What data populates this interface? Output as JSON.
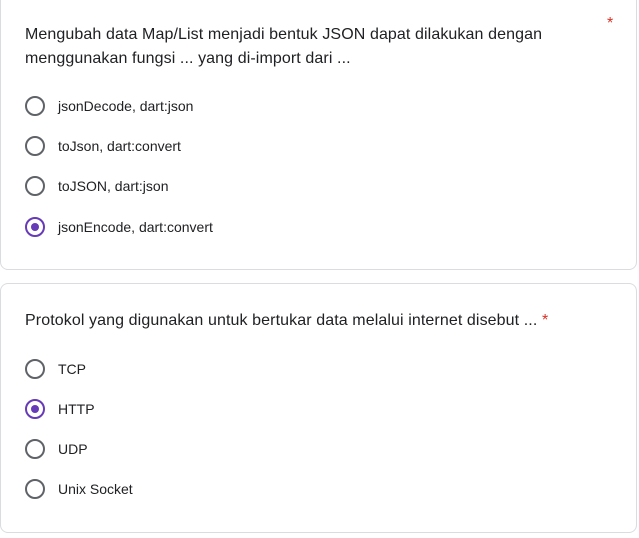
{
  "questions": [
    {
      "line1": "Mengubah data Map/List menjadi bentuk JSON dapat dilakukan dengan",
      "line2": "menggunakan fungsi ... yang di-import dari ...",
      "required_mark": "*",
      "options": [
        {
          "label": "jsonDecode, dart:json",
          "selected": false
        },
        {
          "label": "toJson, dart:convert",
          "selected": false
        },
        {
          "label": "toJSON, dart:json",
          "selected": false
        },
        {
          "label": "jsonEncode, dart:convert",
          "selected": true
        }
      ]
    },
    {
      "line1": "Protokol yang digunakan untuk bertukar data melalui internet disebut ...",
      "required_mark": "*",
      "options": [
        {
          "label": "TCP",
          "selected": false
        },
        {
          "label": "HTTP",
          "selected": true
        },
        {
          "label": "UDP",
          "selected": false
        },
        {
          "label": "Unix Socket",
          "selected": false
        }
      ]
    }
  ],
  "colors": {
    "accent": "#673ab7",
    "required": "#d93025"
  }
}
